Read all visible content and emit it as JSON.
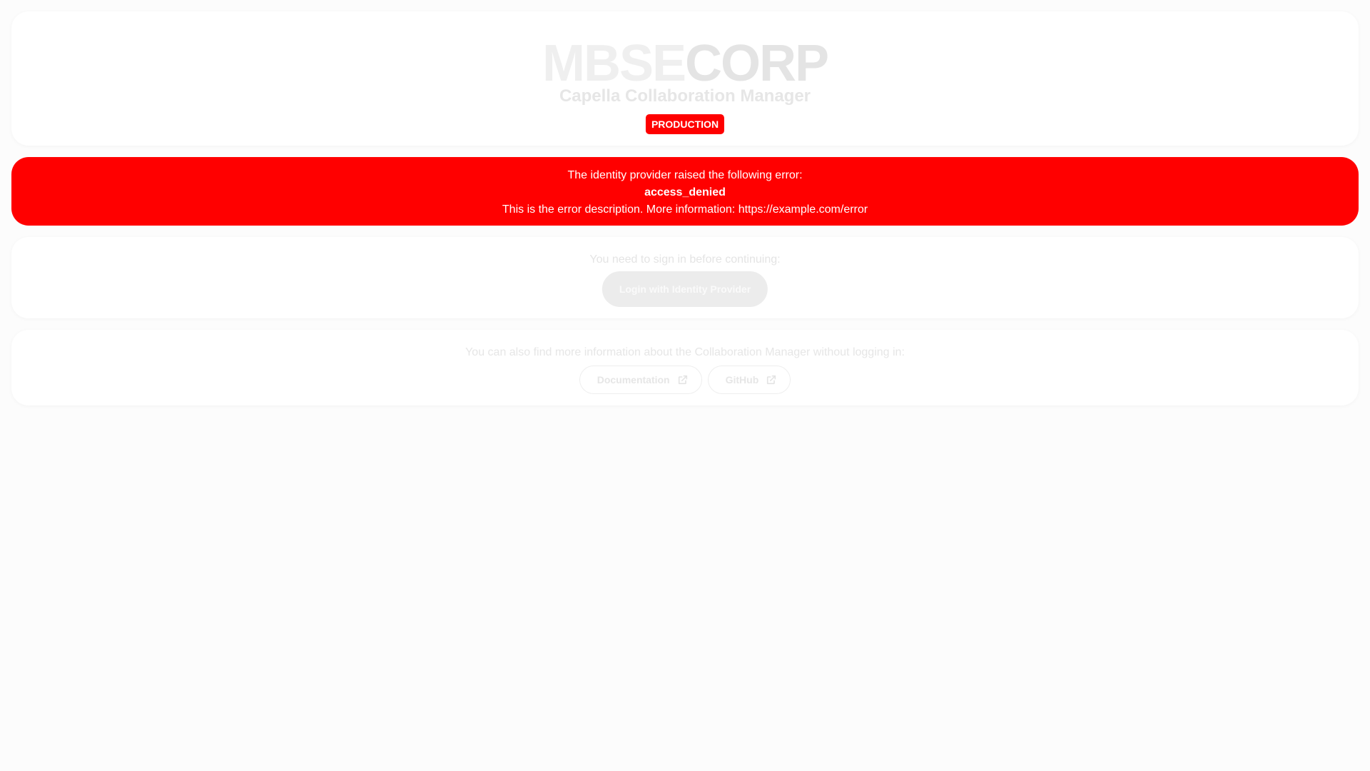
{
  "header": {
    "logo_part1": "MBSE",
    "logo_part2": "CORP",
    "app_title": "Capella Collaboration Manager",
    "environment_badge": "PRODUCTION"
  },
  "error": {
    "intro": "The identity provider raised the following error:",
    "code": "access_denied",
    "description": "This is the error description. More information: https://example.com/error"
  },
  "signin": {
    "prompt": "You need to sign in before continuing:",
    "button_label": "Login with Identity Provider"
  },
  "info": {
    "text": "You can also find more information about the Collaboration Manager without logging in:",
    "links": [
      {
        "label": "Documentation",
        "icon": "external-link-icon"
      },
      {
        "label": "GitHub",
        "icon": "external-link-icon"
      }
    ]
  },
  "colors": {
    "error_background": "#ff0000",
    "badge_background": "#ff0000",
    "page_background": "#fcfcfc"
  }
}
